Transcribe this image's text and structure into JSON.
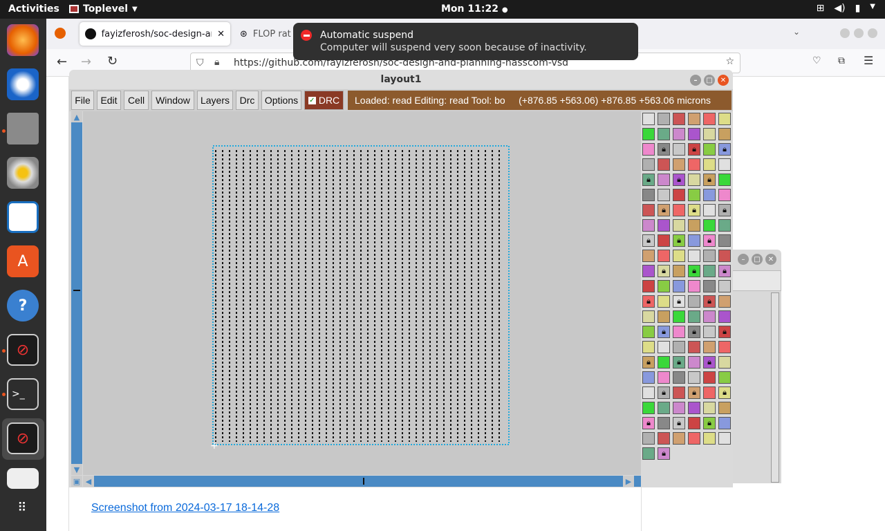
{
  "topbar": {
    "activities": "Activities",
    "app_name": "Toplevel",
    "clock": "Mon 11:22"
  },
  "dock": {
    "items": [
      "firefox-icon",
      "thunderbird-icon",
      "files-icon",
      "rhythmbox-icon",
      "writer-icon",
      "software-icon",
      "help-icon",
      "magic-icon",
      "terminal-icon",
      "magic-active-icon",
      "text-editor-icon",
      "apps-grid-icon"
    ]
  },
  "browser": {
    "tabs": [
      {
        "label": "fayizferosh/soc-design-ar"
      },
      {
        "label": "FLOP rat"
      }
    ],
    "url": "https://github.com/fayizferosh/soc-design-and-planning-nasscom-vsd",
    "link_text": "Screenshot from 2024-03-17 18-14-28"
  },
  "notification": {
    "title": "Automatic suspend",
    "body": "Computer will suspend very soon because of inactivity."
  },
  "magic": {
    "title": "layout1",
    "menu": [
      "File",
      "Edit",
      "Cell",
      "Window",
      "Layers",
      "Drc",
      "Options"
    ],
    "drc_label": "DRC",
    "status": "Loaded: read Editing: read Tool: bo     (+876.85 +563.06) +876.85 +563.06 microns"
  },
  "colors": {
    "accent": "#4a8ac4",
    "status_bg": "#8c5a2d",
    "drc_bg": "#8a3a25"
  }
}
